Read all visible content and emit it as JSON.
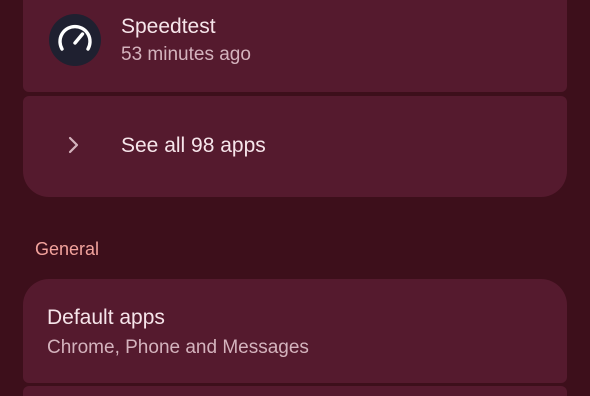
{
  "recent_apps": {
    "items": [
      {
        "name": "Speedtest",
        "last_used": "53 minutes ago",
        "icon": "speedtest-gauge-icon"
      }
    ],
    "see_all_label": "See all 98 apps",
    "see_all_icon": "chevron-right-icon"
  },
  "general": {
    "header": "General",
    "default_apps": {
      "title": "Default apps",
      "subtitle": "Chrome, Phone and Messages"
    }
  },
  "colors": {
    "background": "#3d0f1b",
    "card": "#551a2e",
    "accent": "#f3a39d"
  }
}
